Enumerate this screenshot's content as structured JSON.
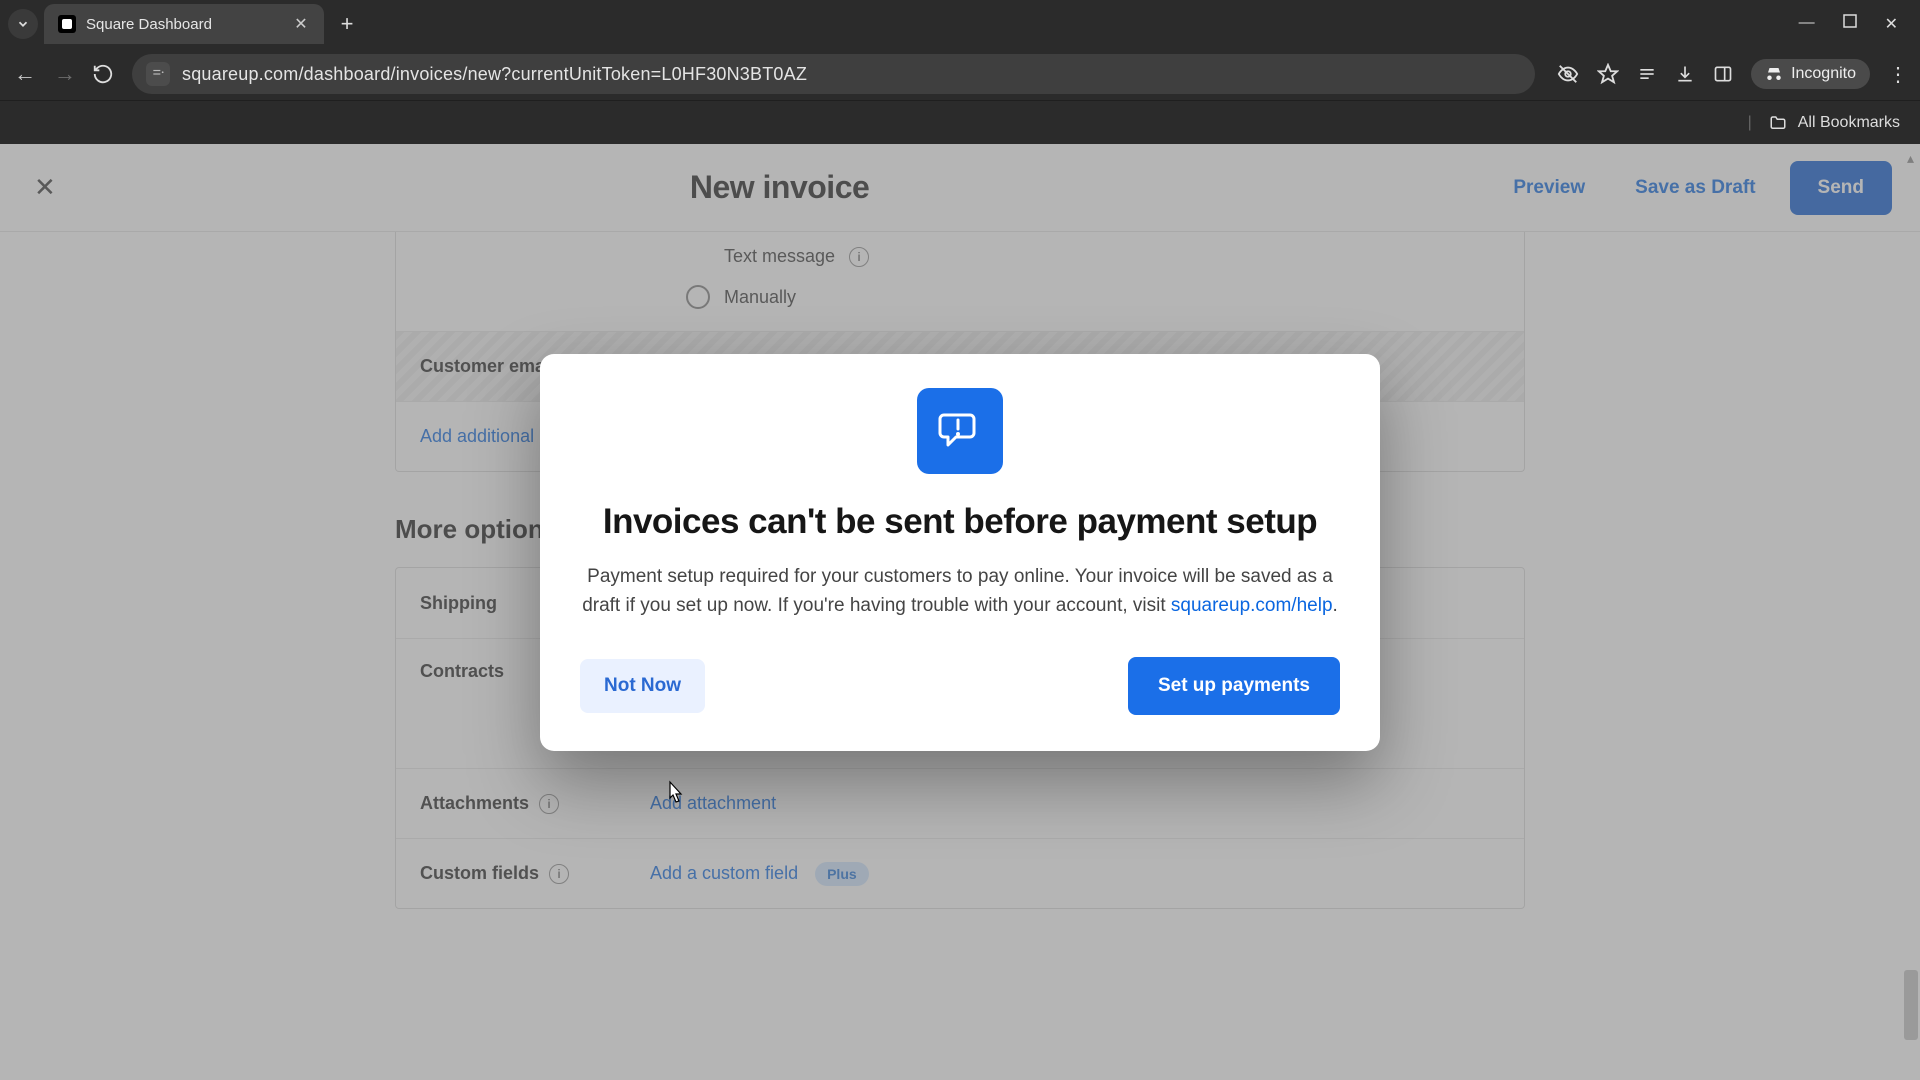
{
  "browser": {
    "tab_title": "Square Dashboard",
    "url": "squareup.com/dashboard/invoices/new?currentUnitToken=L0HF30N3BT0AZ",
    "incognito_label": "Incognito",
    "bookmarks_label": "All Bookmarks"
  },
  "header": {
    "title": "New invoice",
    "preview": "Preview",
    "save_draft": "Save as Draft",
    "send": "Send"
  },
  "delivery": {
    "text_message": "Text message",
    "manually": "Manually"
  },
  "customer": {
    "email_row_label": "Customer email",
    "add_additional": "Add additional"
  },
  "more_options": {
    "heading": "More options",
    "shipping": "Shipping",
    "contracts": "Contracts",
    "attachments": {
      "label": "Attachments",
      "link": "Add attachment"
    },
    "custom_fields": {
      "label": "Custom fields",
      "link": "Add a custom field",
      "badge": "Plus"
    }
  },
  "modal": {
    "title": "Invoices can't be sent before payment setup",
    "body_pre": "Payment setup required for your customers to pay online. Your invoice will be saved as a draft if you set up now. If you're having trouble with your account, visit ",
    "help_link": "squareup.com/help",
    "body_post": ".",
    "not_now": "Not Now",
    "setup": "Set up payments"
  }
}
